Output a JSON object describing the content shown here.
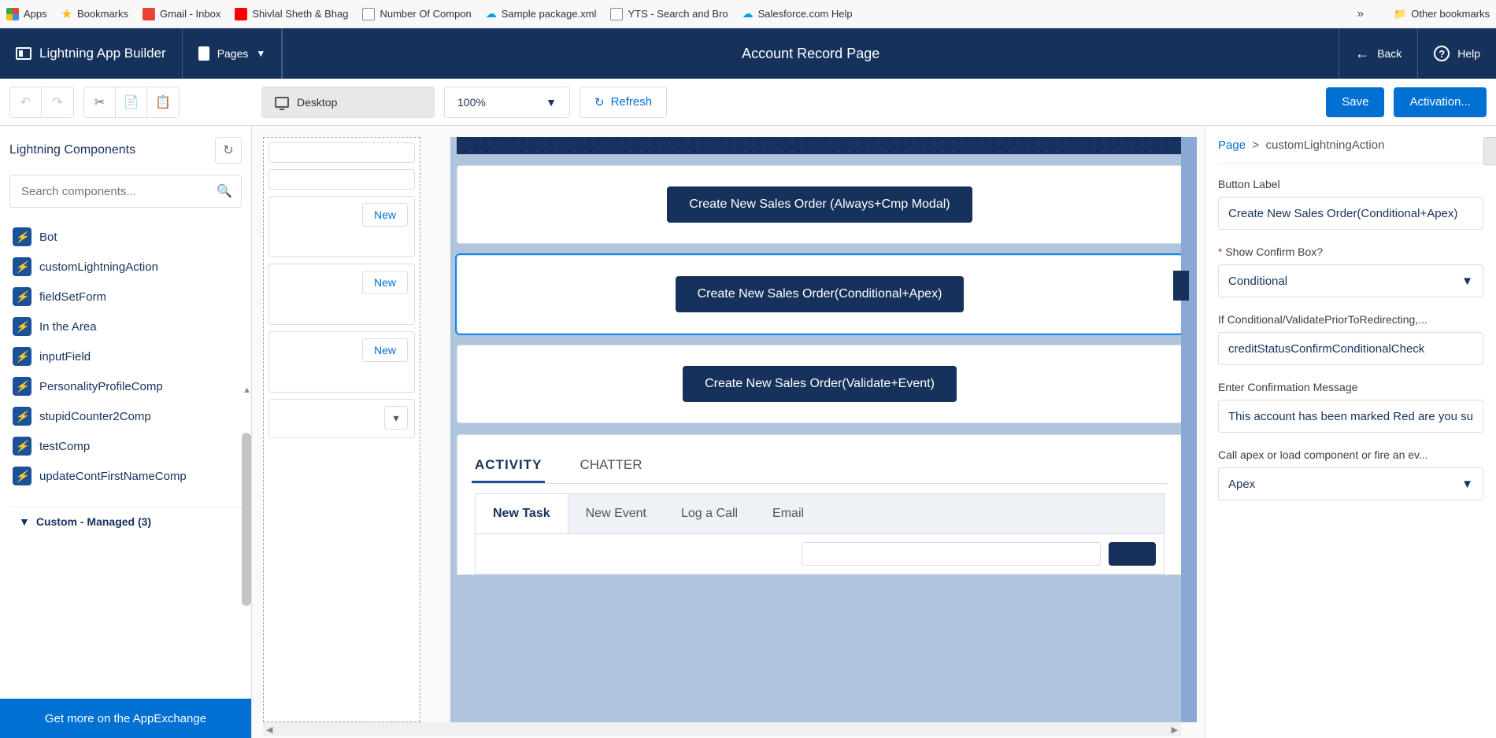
{
  "bookmarks": {
    "apps": "Apps",
    "bookmarks": "Bookmarks",
    "gmail": "Gmail - Inbox",
    "shivlal": "Shivlal Sheth & Bhag",
    "compon": "Number Of Compon",
    "sample": "Sample package.xml",
    "yts": "YTS - Search and Bro",
    "sfhelp": "Salesforce.com Help",
    "other": "Other bookmarks"
  },
  "header": {
    "appBuilder": "Lightning App Builder",
    "pages": "Pages",
    "title": "Account Record Page",
    "back": "Back",
    "help": "Help"
  },
  "toolbar": {
    "device": "Desktop",
    "zoom": "100%",
    "refresh": "Refresh",
    "save": "Save",
    "activation": "Activation..."
  },
  "leftPanel": {
    "title": "Lightning Components",
    "searchPlaceholder": "Search components...",
    "items": [
      "Bot",
      "customLightningAction",
      "fieldSetForm",
      "In the Area",
      "inputField",
      "PersonalityProfileComp",
      "stupidCounter2Comp",
      "testComp",
      "updateContFirstNameComp"
    ],
    "sectionLabel": "Custom - Managed (3)",
    "footer": "Get more on the AppExchange"
  },
  "canvas": {
    "newBtn": "New",
    "action1": "Create New Sales Order (Always+Cmp Modal)",
    "action2": "Create New Sales Order(Conditional+Apex)",
    "action3": "Create New Sales Order(Validate+Event)",
    "tabActivity": "ACTIVITY",
    "tabChatter": "CHATTER",
    "subtabs": [
      "New Task",
      "New Event",
      "Log a Call",
      "Email"
    ]
  },
  "rightPanel": {
    "breadcrumbPage": "Page",
    "breadcrumbComp": "customLightningAction",
    "fields": {
      "buttonLabel": {
        "label": "Button Label",
        "value": "Create New Sales Order(Conditional+Apex)"
      },
      "showConfirm": {
        "label": "Show Confirm Box?",
        "value": "Conditional",
        "required": true
      },
      "ifConditional": {
        "label": "If Conditional/ValidatePriorToRedirecting,...",
        "value": "creditStatusConfirmConditionalCheck"
      },
      "confirmMsg": {
        "label": "Enter Confirmation Message",
        "value": "This account has been marked Red are you sure"
      },
      "callApex": {
        "label": "Call apex or load component or fire an ev...",
        "value": "Apex"
      }
    }
  }
}
